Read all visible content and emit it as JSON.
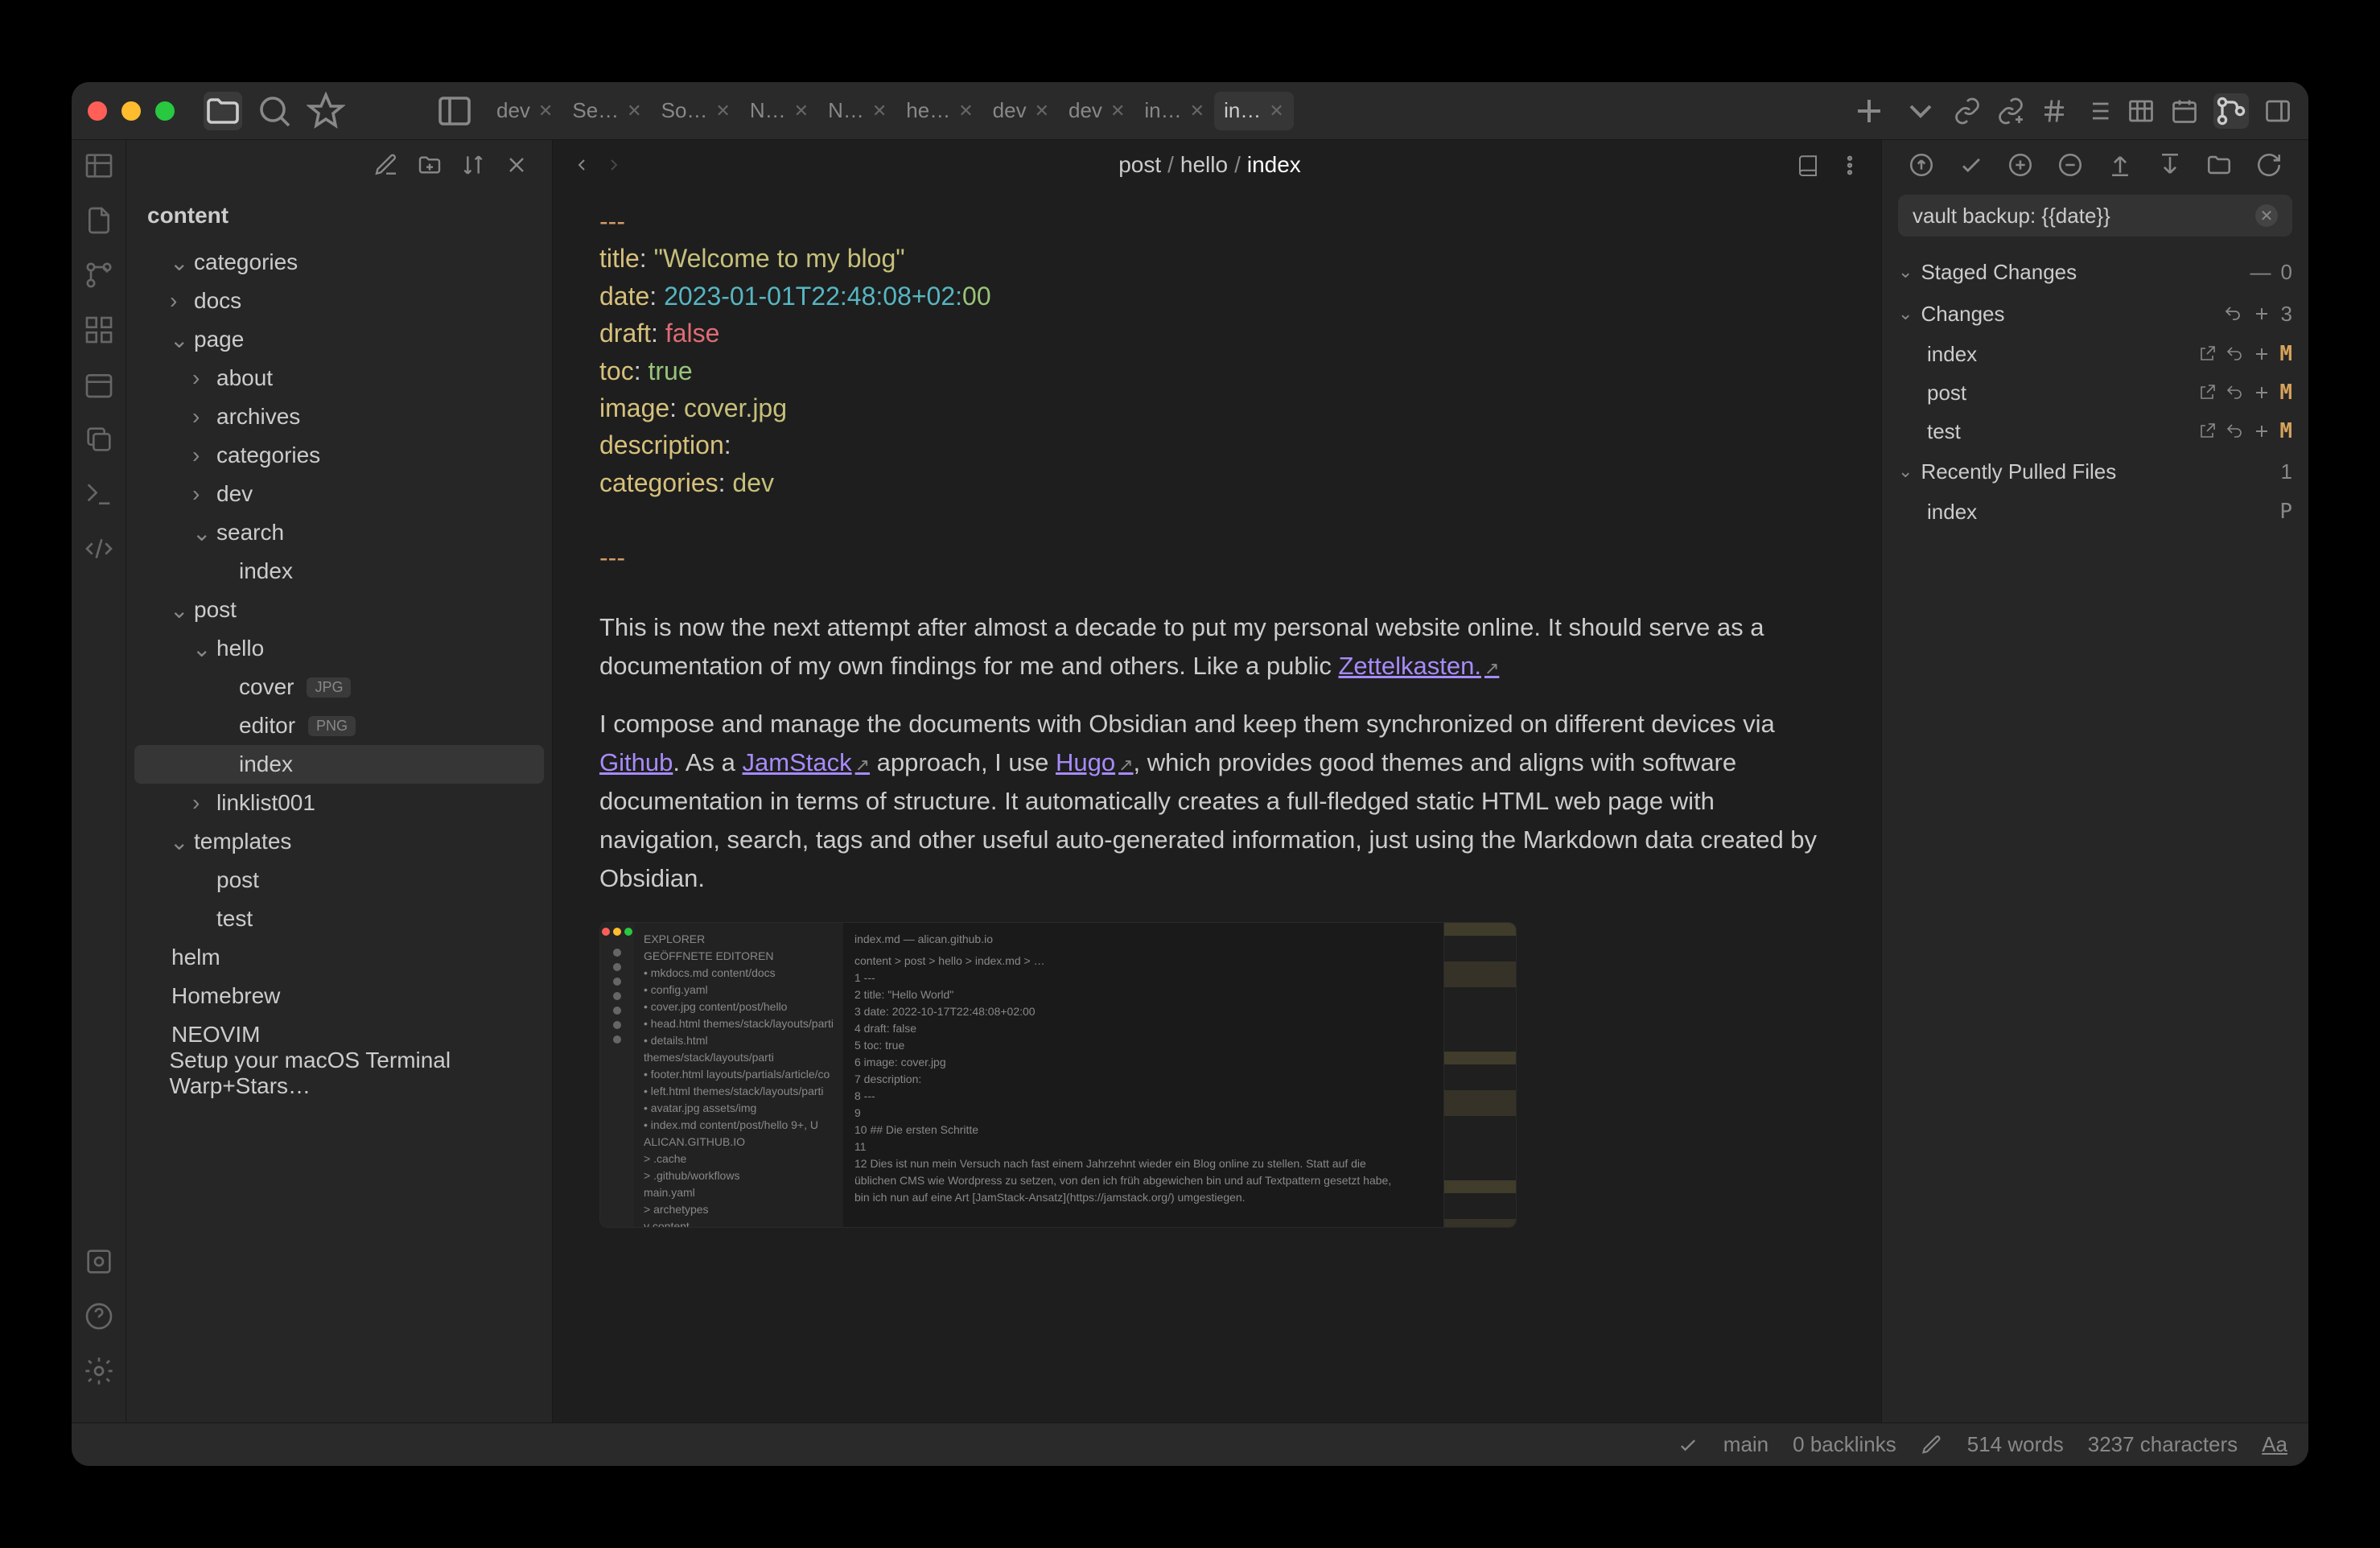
{
  "titlebar_tabs": [
    {
      "label": "dev",
      "close": true
    },
    {
      "label": "Se…",
      "close": true
    },
    {
      "label": "So…",
      "close": true
    },
    {
      "label": "N…",
      "close": true
    },
    {
      "label": "N…",
      "close": true
    },
    {
      "label": "he…",
      "close": true
    },
    {
      "label": "dev",
      "close": true
    },
    {
      "label": "dev",
      "close": true
    },
    {
      "label": "in…",
      "close": true
    },
    {
      "label": "in…",
      "close": true,
      "active": true
    }
  ],
  "sidebar": {
    "title": "content",
    "tree": [
      {
        "depth": 0,
        "chev": "v",
        "label": "categories"
      },
      {
        "depth": 0,
        "chev": ">",
        "label": "docs"
      },
      {
        "depth": 0,
        "chev": "v",
        "label": "page"
      },
      {
        "depth": 1,
        "chev": ">",
        "label": "about"
      },
      {
        "depth": 1,
        "chev": ">",
        "label": "archives"
      },
      {
        "depth": 1,
        "chev": ">",
        "label": "categories"
      },
      {
        "depth": 1,
        "chev": ">",
        "label": "dev"
      },
      {
        "depth": 1,
        "chev": "v",
        "label": "search"
      },
      {
        "depth": 2,
        "chev": "",
        "label": "index"
      },
      {
        "depth": 0,
        "chev": "v",
        "label": "post"
      },
      {
        "depth": 1,
        "chev": "v",
        "label": "hello"
      },
      {
        "depth": 2,
        "chev": "",
        "label": "cover",
        "badge": "JPG"
      },
      {
        "depth": 2,
        "chev": "",
        "label": "editor",
        "badge": "PNG"
      },
      {
        "depth": 2,
        "chev": "",
        "label": "index",
        "active": true
      },
      {
        "depth": 1,
        "chev": ">",
        "label": "linklist001"
      },
      {
        "depth": 0,
        "chev": "v",
        "label": "templates"
      },
      {
        "depth": 1,
        "chev": "",
        "label": "post"
      },
      {
        "depth": 1,
        "chev": "",
        "label": "test"
      },
      {
        "depth": -1,
        "chev": "",
        "label": "helm"
      },
      {
        "depth": -1,
        "chev": "",
        "label": "Homebrew"
      },
      {
        "depth": -1,
        "chev": "",
        "label": "NEOVIM"
      },
      {
        "depth": -1,
        "chev": "",
        "label": "Setup your macOS Terminal Warp+Stars…"
      }
    ]
  },
  "breadcrumb": [
    "post",
    "hello",
    "index"
  ],
  "frontmatter": {
    "title_key": "title",
    "title_val": "\"Welcome to my blog\"",
    "date_key": "date",
    "date_val": "2023-01-01T22:48:08+02:",
    "date_tz": "00",
    "draft_key": "draft",
    "draft_val": "false",
    "toc_key": "toc",
    "toc_val": "true",
    "image_key": "image",
    "image_val": "cover.jpg",
    "desc_key": "description",
    "desc_val": "",
    "cat_key": "categories",
    "cat_val": "dev",
    "dashes": "---"
  },
  "body": {
    "p1a": "This is now the next attempt after almost a decade to put my personal website online. It should serve as a documentation of my own findings for me and others. Like a public ",
    "zettel": "Zettelkasten.",
    "p2a": "I compose and manage the documents with Obsidian and keep them synchronized on different devices via ",
    "github": "Github",
    "p2b": ". As a ",
    "jamstack": "JamStack",
    "p2c": " approach, I use ",
    "hugo": "Hugo",
    "p2d": ", which provides good themes and aligns with software documentation in terms of structure. It automatically creates a full-fledged static HTML web page with navigation, search, tags and other useful auto-generated information, just using the Markdown data created by Obsidian."
  },
  "git": {
    "commit_msg": "vault backup: {{date}}",
    "staged_label": "Staged Changes",
    "staged_count": "0",
    "changes_label": "Changes",
    "changes_count": "3",
    "files": [
      {
        "name": "index",
        "status": "M"
      },
      {
        "name": "post",
        "status": "M"
      },
      {
        "name": "test",
        "status": "M"
      }
    ],
    "recent_label": "Recently Pulled Files",
    "recent_count": "1",
    "recent_files": [
      {
        "name": "index",
        "status": "P"
      }
    ]
  },
  "status": {
    "branch": "main",
    "backlinks": "0 backlinks",
    "words": "514 words",
    "chars": "3237 characters",
    "aa": "Aa"
  },
  "embedded": {
    "title": "index.md — alican.github.io",
    "side_lines": [
      "EXPLORER",
      "GEÖFFNETE EDITOREN",
      "• mkdocs.md  content/docs",
      "• config.yaml",
      "• cover.jpg  content/post/hello",
      "• head.html themes/stack/layouts/parti",
      "• details.html themes/stack/layouts/parti",
      "• footer.html layouts/partials/article/co",
      "• left.html themes/stack/layouts/parti",
      "• avatar.jpg assets/img",
      "• index.md content/post/hello  9+, U",
      "ALICAN.GITHUB.IO",
      "> .cache",
      "> .github/workflows",
      "  main.yaml",
      "> archetypes",
      "v content"
    ],
    "main_lines": [
      "content > post > hello > index.md > …",
      "  1   ---",
      "  2   title: \"Hello World\"",
      "  3   date: 2022-10-17T22:48:08+02:00",
      "  4   draft: false",
      "  5   toc: true",
      "  6   image: cover.jpg",
      "  7   description:",
      "  8   ---",
      "  9",
      "  10  ## Die ersten Schritte",
      "  11",
      "  12  Dies ist nun mein Versuch nach fast einem Jahrzehnt wieder ein Blog online zu stellen. Statt auf die",
      "       üblichen CMS wie Wordpress zu setzen, von den ich früh abgewichen bin und auf Textpattern gesetzt habe,",
      "       bin ich nun auf eine Art [JamStack-Ansatz](https://jamstack.org/) umgestiegen."
    ]
  }
}
